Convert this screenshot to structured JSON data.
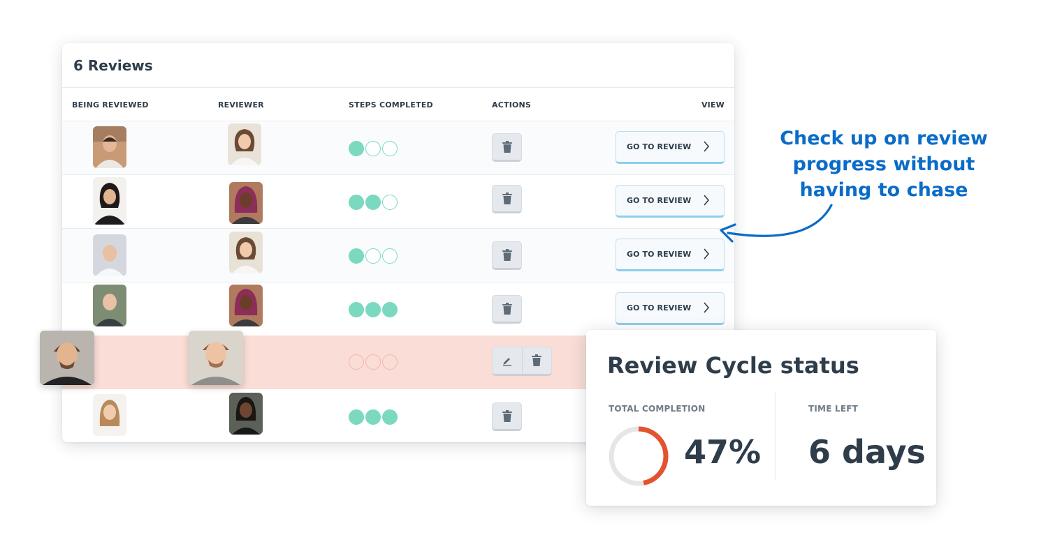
{
  "reviews": {
    "title": "6 Reviews",
    "columns": {
      "being_reviewed": "BEING REVIEWED",
      "reviewer": "REVIEWER",
      "steps": "STEPS COMPLETED",
      "actions": "ACTIONS",
      "view": "VIEW"
    },
    "go_label": "GO TO REVIEW",
    "rows": [
      {
        "steps_completed": 1,
        "view": true
      },
      {
        "steps_completed": 2,
        "view": true
      },
      {
        "steps_completed": 1,
        "view": true
      },
      {
        "steps_completed": 3,
        "view": true
      },
      {
        "steps_completed": 0,
        "view": false,
        "dragging": true
      },
      {
        "steps_completed": 3,
        "view": false
      }
    ],
    "colors": {
      "step": "#7ad9bf",
      "highlight": "#f9ddd6",
      "button_border": "#8fcdec"
    }
  },
  "status": {
    "title": "Review Cycle status",
    "completion_label": "TOTAL COMPLETION",
    "completion": "47%",
    "completion_value": 0.47,
    "time_left_label": "TIME LEFT",
    "time_left": "6 days",
    "colors": {
      "progress": "#e4532f",
      "track": "#e6e6e6"
    }
  },
  "callout": {
    "text": "Check up on review progress without having to chase",
    "color": "#0a6cc8"
  }
}
